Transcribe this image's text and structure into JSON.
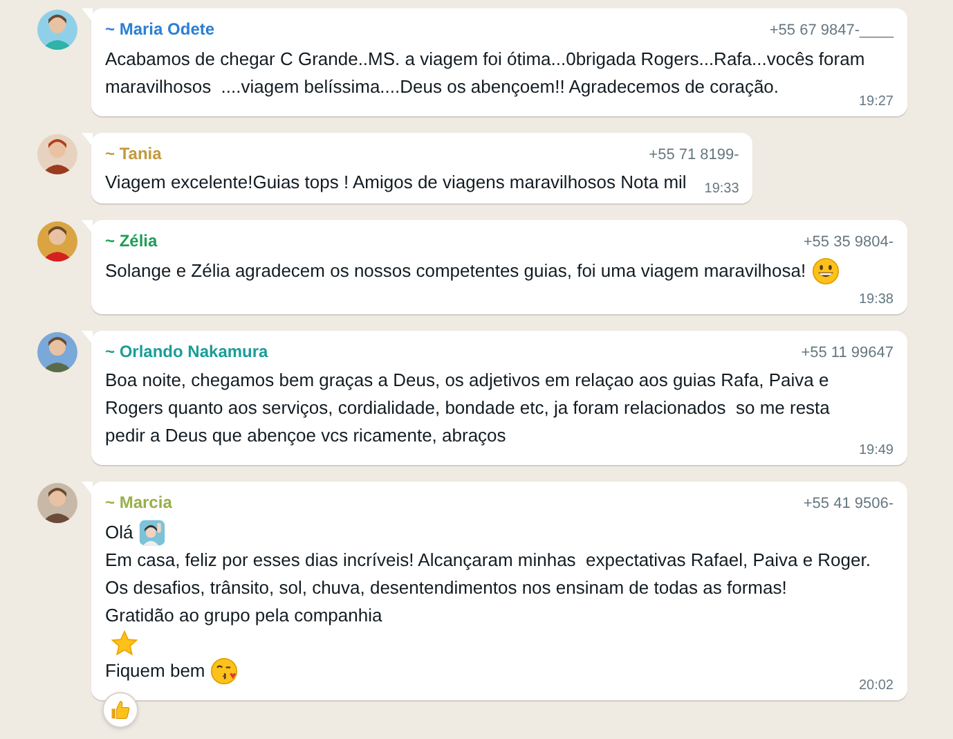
{
  "messages": [
    {
      "name": "~ Maria Odete",
      "color": "#2a7fd4",
      "phone": "+55 67 9847-____",
      "time": "19:27",
      "wide": true,
      "time_row": false,
      "paragraphs": [
        {
          "kind": "plain",
          "lines": [
            "Acabamos de chegar C Grande..MS. a viagem foi ótima...0brigada Rogers...Rafa...vocês foram",
            "maravilhosos  ....viagem belíssima....Deus os abençoem!! Agradecemos de coração."
          ]
        }
      ]
    },
    {
      "name": "~ Tania",
      "color": "#c29a3f",
      "phone": "+55 71 8199-",
      "time": "19:33",
      "wide": false,
      "time_row": false,
      "paragraphs": [
        {
          "kind": "plain",
          "lines": [
            "Viagem excelente!Guias tops ! Amigos de viagens maravilhosos Nota mil"
          ]
        }
      ]
    },
    {
      "name": "~ Zélia",
      "color": "#1f9d55",
      "phone": "+55 35 9804-",
      "time": "19:38",
      "wide": true,
      "time_row": true,
      "paragraphs": [
        {
          "kind": "grin",
          "lines": [
            "Solange e Zélia agradecem os nossos competentes guias, foi uma viagem maravilhosa!"
          ]
        }
      ]
    },
    {
      "name": "~ Orlando Nakamura",
      "color": "#1a9e98",
      "phone": "+55 11 99647",
      "time": "19:49",
      "wide": true,
      "time_row": false,
      "paragraphs": [
        {
          "kind": "plain",
          "lines": [
            "Boa noite, chegamos bem graças a Deus, os adjetivos em relaçao aos guias Rafa, Paiva e",
            "Rogers quanto aos serviços, cordialidade, bondade etc, ja foram relacionados  so me resta",
            "pedir a Deus que abençoe vcs ricamente, abraços"
          ]
        }
      ]
    },
    {
      "name": "~ Marcia",
      "color": "#98b04a",
      "phone": "+55 41 9506-",
      "time": "20:02",
      "wide": true,
      "time_row": false,
      "reaction": {
        "kind": "thumbs"
      },
      "paragraphs": [
        {
          "kind": "wave",
          "lines": [
            "Olá"
          ]
        },
        {
          "kind": "plain",
          "lines": [
            "Em casa, feliz por esses dias incríveis! Alcançaram minhas  expectativas Rafael, Paiva e Roger.",
            "Os desafios, trânsito, sol, chuva, desentendimentos nos ensinam de todas as formas!",
            "Gratidão ao grupo pela companhia"
          ]
        },
        {
          "kind": "star"
        },
        {
          "kind": "kiss",
          "lines": [
            "Fiquem bem"
          ]
        }
      ]
    }
  ]
}
